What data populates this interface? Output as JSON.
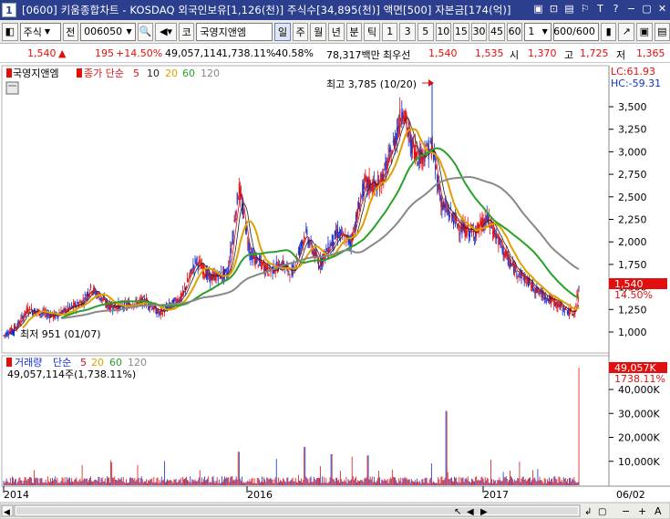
{
  "window": {
    "number": "1",
    "title": "[0600] 키움종합차트 - KOSDAQ 외국인보유[1,126(천)] 주식수[34,895(천)] 액면[500] 자본금[174(억)]"
  },
  "toolbar": {
    "market_select": "주식",
    "whole_btn": "전",
    "code_input": "006050",
    "stock_btn": "코",
    "stock_name": "국영지앤엠",
    "periods": [
      "일",
      "주",
      "월",
      "년",
      "분",
      "틱"
    ],
    "active_period": "일",
    "intervals": [
      "1",
      "3",
      "5",
      "10",
      "15",
      "30",
      "45",
      "60"
    ],
    "interval_value": "1",
    "count_display": "600/600"
  },
  "pricebar": {
    "price": "1,540",
    "change_sign": "▲",
    "change": "195",
    "change_rate": "+14.50%",
    "volume": "49,057,114",
    "volume_rate": "1,738.11%",
    "volume_rate2": "40.58%",
    "amount": "78,317백만",
    "best_label": "최우선",
    "best_ask": "1,540",
    "best_bid": "1,535",
    "open_label": "시",
    "open": "1,370",
    "high_label": "고",
    "high": "1,725",
    "low_label": "저",
    "low": "1,365"
  },
  "price_panel": {
    "stock_label": "국영지앤엠",
    "ma_label": "종가 단순",
    "ma_periods": [
      "5",
      "10",
      "20",
      "60",
      "120"
    ],
    "ma_colors": [
      "#e01010",
      "#222222",
      "#e0a000",
      "#2aa02a",
      "#888888"
    ],
    "lc": "LC:61.93",
    "hc": "HC:-59.31",
    "high_annotation": "최고 3,785 (10/20)",
    "low_annotation": "최저 951 (01/07)",
    "current_price_tag": "1,540",
    "current_rate_tag": "14.50%",
    "y_ticks": [
      "3,500",
      "3,250",
      "3,000",
      "2,750",
      "2,500",
      "2,250",
      "2,000",
      "1,750",
      "1,500",
      "1,250",
      "1,000"
    ]
  },
  "volume_panel": {
    "label": "거래량",
    "ma_label": "단순",
    "ma_periods": [
      "5",
      "20",
      "60",
      "120"
    ],
    "value_text": "49,057,114주(1,738.11%)",
    "current_tag": "49,057K",
    "current_rate_tag": "1738.11%",
    "y_ticks": [
      "40,000K",
      "30,000K",
      "20,000K",
      "10,000K"
    ]
  },
  "x_axis": {
    "labels": [
      "2014",
      "2016",
      "2017",
      "06/02"
    ]
  },
  "colors": {
    "title_bg": "#2c3f8f",
    "up": "#e01010",
    "down": "#1030d0"
  }
}
